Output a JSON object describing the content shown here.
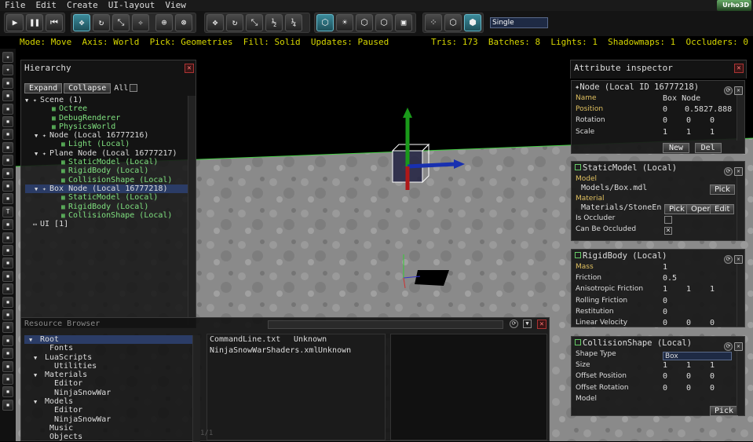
{
  "menu": [
    "File",
    "Edit",
    "Create",
    "UI-layout",
    "View"
  ],
  "logo": "Urho3D",
  "toolbar": {
    "buttons": [
      {
        "icon": "play-icon",
        "glyph": "▶"
      },
      {
        "icon": "pause-icon",
        "glyph": "❚❚"
      },
      {
        "icon": "restart-icon",
        "glyph": "⏮"
      },
      {
        "icon": "move-gizmo-icon",
        "glyph": "✥"
      },
      {
        "icon": "rotate-gizmo-icon",
        "glyph": "↻"
      },
      {
        "icon": "scale-gizmo-icon",
        "glyph": "⤡"
      },
      {
        "icon": "select-gizmo-icon",
        "glyph": "✧"
      },
      {
        "icon": "local-axis-icon",
        "glyph": "⊕"
      },
      {
        "icon": "world-axis-icon",
        "glyph": "⊛"
      },
      {
        "icon": "move-snap-icon",
        "glyph": "✥"
      },
      {
        "icon": "rotate-snap-icon",
        "glyph": "↻"
      },
      {
        "icon": "scale-snap-icon",
        "glyph": "⤡"
      },
      {
        "icon": "scale-half-icon",
        "glyph": "½"
      },
      {
        "icon": "scale-quarter-icon",
        "glyph": "¼"
      },
      {
        "icon": "pick-geometries-icon",
        "glyph": "⬡"
      },
      {
        "icon": "pick-lights-icon",
        "glyph": "☀"
      },
      {
        "icon": "pick-zones-icon",
        "glyph": "⬡"
      },
      {
        "icon": "pick-rigidbodies-icon",
        "glyph": "⬡"
      },
      {
        "icon": "pick-ui-icon",
        "glyph": "▣"
      },
      {
        "icon": "fill-points-icon",
        "glyph": "⁘"
      },
      {
        "icon": "fill-wireframe-icon",
        "glyph": "⬡"
      },
      {
        "icon": "fill-solid-icon",
        "glyph": "⬢"
      }
    ],
    "view_mode": "Single"
  },
  "status": {
    "left": "Mode: Move  Axis: World  Pick: Geometries  Fill: Solid  Updates: Paused",
    "right": "Tris: 173  Batches: 8  Lights: 1  Shadowmaps: 1  Occluders: 0"
  },
  "sidebar_icons": [
    "star-icon",
    "star-icon",
    "node-icon",
    "node-icon",
    "node-icon",
    "node-icon",
    "node-icon",
    "node-icon",
    "node-icon",
    "node-icon",
    "node-icon",
    "node-icon",
    "text-icon",
    "node-icon",
    "node-icon",
    "node-icon",
    "node-icon",
    "node-icon",
    "node-icon",
    "node-icon",
    "node-icon",
    "node-icon",
    "node-icon",
    "node-icon",
    "node-icon",
    "node-icon",
    "node-icon",
    "node-icon"
  ],
  "hierarchy": {
    "title": "Hierarchy",
    "expand": "Expand",
    "collapse": "Collapse",
    "all": "All",
    "items": [
      {
        "label": "Scene (1)",
        "indent": 0,
        "arrow": "▼",
        "type": "node"
      },
      {
        "label": "Octree",
        "indent": 2,
        "arrow": "",
        "type": "comp"
      },
      {
        "label": "DebugRenderer",
        "indent": 2,
        "arrow": "",
        "type": "comp"
      },
      {
        "label": "PhysicsWorld",
        "indent": 2,
        "arrow": "",
        "type": "comp"
      },
      {
        "label": "Node (Local 16777216)",
        "indent": 1,
        "arrow": "▼",
        "type": "node"
      },
      {
        "label": "Light (Local)",
        "indent": 3,
        "arrow": "",
        "type": "comp"
      },
      {
        "label": "Plane Node (Local 16777217)",
        "indent": 1,
        "arrow": "▼",
        "type": "node"
      },
      {
        "label": "StaticModel (Local)",
        "indent": 3,
        "arrow": "",
        "type": "comp"
      },
      {
        "label": "RigidBody (Local)",
        "indent": 3,
        "arrow": "",
        "type": "comp"
      },
      {
        "label": "CollisionShape (Local)",
        "indent": 3,
        "arrow": "",
        "type": "comp"
      },
      {
        "label": "Box Node (Local 16777218)",
        "indent": 1,
        "arrow": "▼",
        "type": "node",
        "selected": true
      },
      {
        "label": "StaticModel (Local)",
        "indent": 3,
        "arrow": "",
        "type": "comp"
      },
      {
        "label": "RigidBody (Local)",
        "indent": 3,
        "arrow": "",
        "type": "comp"
      },
      {
        "label": "CollisionShape (Local)",
        "indent": 3,
        "arrow": "",
        "type": "comp"
      },
      {
        "label": "UI [1]",
        "indent": 0,
        "arrow": "",
        "type": "ui"
      }
    ]
  },
  "resource_browser": {
    "title": "Resource Browser",
    "footer": "1/1",
    "tree": [
      {
        "label": "Root",
        "indent": 1,
        "arrow": "▼",
        "selected": true
      },
      {
        "label": "Fonts",
        "indent": 3,
        "arrow": ""
      },
      {
        "label": "LuaScripts",
        "indent": 2,
        "arrow": "▼"
      },
      {
        "label": "Utilities",
        "indent": 4,
        "arrow": ""
      },
      {
        "label": "Materials",
        "indent": 2,
        "arrow": "▼"
      },
      {
        "label": "Editor",
        "indent": 4,
        "arrow": ""
      },
      {
        "label": "NinjaSnowWar",
        "indent": 4,
        "arrow": ""
      },
      {
        "label": "Models",
        "indent": 2,
        "arrow": "▼"
      },
      {
        "label": "Editor",
        "indent": 4,
        "arrow": ""
      },
      {
        "label": "NinjaSnowWar",
        "indent": 4,
        "arrow": ""
      },
      {
        "label": "Music",
        "indent": 3,
        "arrow": ""
      },
      {
        "label": "Objects",
        "indent": 3,
        "arrow": ""
      }
    ],
    "files": [
      {
        "name": "CommandLine.txt",
        "type": "Unknown"
      },
      {
        "name": "NinjaSnowWarShaders.xml",
        "type": "Unknown"
      }
    ]
  },
  "inspector": {
    "title": "Attribute inspector",
    "node": {
      "header": "Node (Local ID 16777218)",
      "name_label": "Name",
      "name_value": "Box Node",
      "position_label": "Position",
      "position": [
        "0",
        "0.5827.888"
      ],
      "rotation_label": "Rotation",
      "rotation": [
        "0",
        "0",
        "0"
      ],
      "scale_label": "Scale",
      "scale": [
        "1",
        "1",
        "1"
      ],
      "new": "New",
      "del": "Del"
    },
    "static_model": {
      "header": "StaticModel (Local)",
      "model_label": "Model",
      "model_value": "Models/Box.mdl",
      "material_label": "Material",
      "material_value": "Materials/StoneEn",
      "pick": "Pick",
      "open": "Open",
      "edit": "Edit",
      "occluder_label": "Is Occluder",
      "occluded_label": "Can Be Occluded"
    },
    "rigid_body": {
      "header": "RigidBody (Local)",
      "rows": [
        {
          "label": "Mass",
          "vals": [
            "1"
          ],
          "hl": true
        },
        {
          "label": "Friction",
          "vals": [
            "0.5"
          ]
        },
        {
          "label": "Anisotropic Friction",
          "vals": [
            "1",
            "1",
            "1"
          ]
        },
        {
          "label": "Rolling Friction",
          "vals": [
            "0"
          ]
        },
        {
          "label": "Restitution",
          "vals": [
            "0"
          ]
        },
        {
          "label": "Linear Velocity",
          "vals": [
            "0",
            "0",
            "0"
          ]
        }
      ]
    },
    "collision_shape": {
      "header": "CollisionShape (Local)",
      "rows": [
        {
          "label": "Shape Type",
          "vals": [
            "Box"
          ],
          "dropdown": true
        },
        {
          "label": "Size",
          "vals": [
            "1",
            "1",
            "1"
          ]
        },
        {
          "label": "Offset Position",
          "vals": [
            "0",
            "0",
            "0"
          ]
        },
        {
          "label": "Offset Rotation",
          "vals": [
            "0",
            "0",
            "0"
          ]
        },
        {
          "label": "Model",
          "vals": []
        }
      ],
      "pick": "Pick"
    }
  }
}
